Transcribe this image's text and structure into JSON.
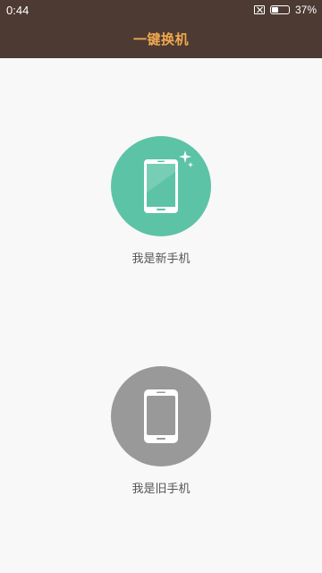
{
  "status_bar": {
    "time": "0:44",
    "battery_percent": "37%",
    "battery_level": 0.37,
    "icons": [
      "sim-disabled-icon",
      "battery-icon"
    ]
  },
  "header": {
    "title": "一键换机"
  },
  "options": [
    {
      "label": "我是新手机",
      "icon": "new-phone-icon",
      "color": "#5dc3a6"
    },
    {
      "label": "我是旧手机",
      "icon": "old-phone-icon",
      "color": "#999999"
    }
  ],
  "colors": {
    "header_bg": "#4d3a33",
    "title_accent": "#f0a850",
    "page_bg": "#f8f8f8"
  }
}
